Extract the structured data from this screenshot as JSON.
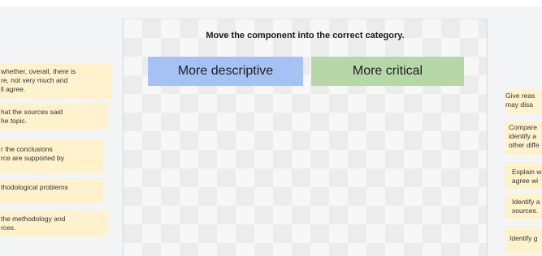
{
  "instruction": "Move the component into the correct category.",
  "categories": {
    "descriptive": "More descriptive",
    "critical": "More critical"
  },
  "left_cards": [
    [
      "whether, overall, there is",
      "re, not very much and",
      "ll agree."
    ],
    [
      "hat the sources said",
      "he topic."
    ],
    [
      "r the conclusions",
      "rce are supported by"
    ],
    [
      "thodological problems"
    ],
    [
      "the methodology and",
      "rces."
    ]
  ],
  "right_cards": [
    [
      "Give reas",
      "may disa"
    ],
    [
      "Compare",
      "identify a",
      "other diffe"
    ],
    [
      "Explain w",
      "agree wi"
    ],
    [
      "Identify a",
      "sources."
    ],
    [
      "Identify g"
    ]
  ],
  "colors": {
    "descriptive": "#a4c2f4",
    "critical": "#b6d7a8",
    "card": "#fff2cc"
  }
}
